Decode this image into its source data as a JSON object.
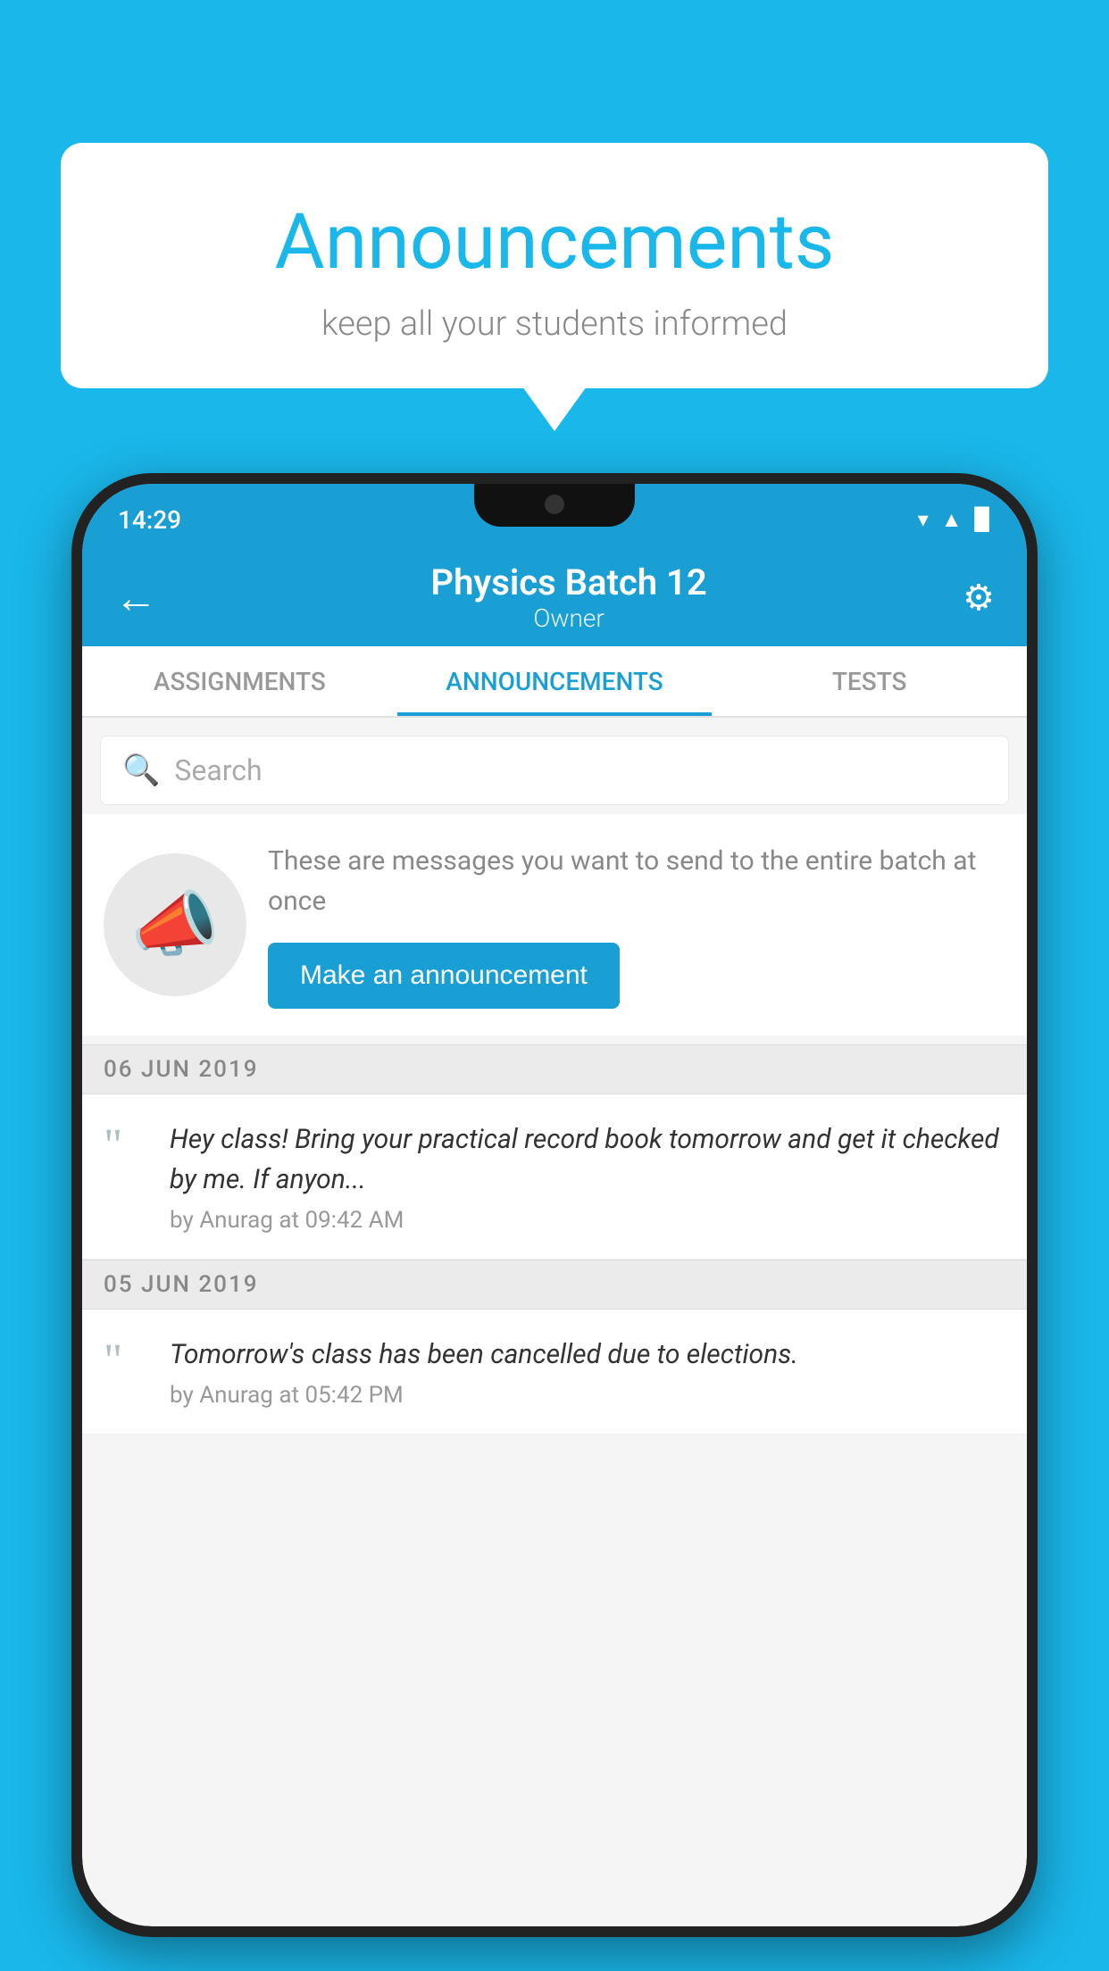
{
  "background_color": "#1ab7ea",
  "speech_bubble": {
    "title": "Announcements",
    "subtitle": "keep all your students informed"
  },
  "phone": {
    "status_bar": {
      "time": "14:29",
      "icons": [
        "wifi",
        "signal",
        "battery"
      ]
    },
    "app_bar": {
      "title": "Physics Batch 12",
      "subtitle": "Owner",
      "back_label": "←",
      "settings_label": "⚙"
    },
    "tabs": [
      {
        "label": "ASSIGNMENTS",
        "active": false
      },
      {
        "label": "ANNOUNCEMENTS",
        "active": true
      },
      {
        "label": "TESTS",
        "active": false
      }
    ],
    "search": {
      "placeholder": "Search"
    },
    "announcement_promo": {
      "description": "These are messages you want to send to the entire batch at once",
      "button_label": "Make an announcement"
    },
    "announcements": [
      {
        "date": "06  JUN  2019",
        "messages": [
          {
            "text": "Hey class! Bring your practical record book tomorrow and get it checked by me. If anyon...",
            "meta": "by Anurag at 09:42 AM"
          }
        ]
      },
      {
        "date": "05  JUN  2019",
        "messages": [
          {
            "text": "Tomorrow's class has been cancelled due to elections.",
            "meta": "by Anurag at 05:42 PM"
          }
        ]
      }
    ]
  }
}
